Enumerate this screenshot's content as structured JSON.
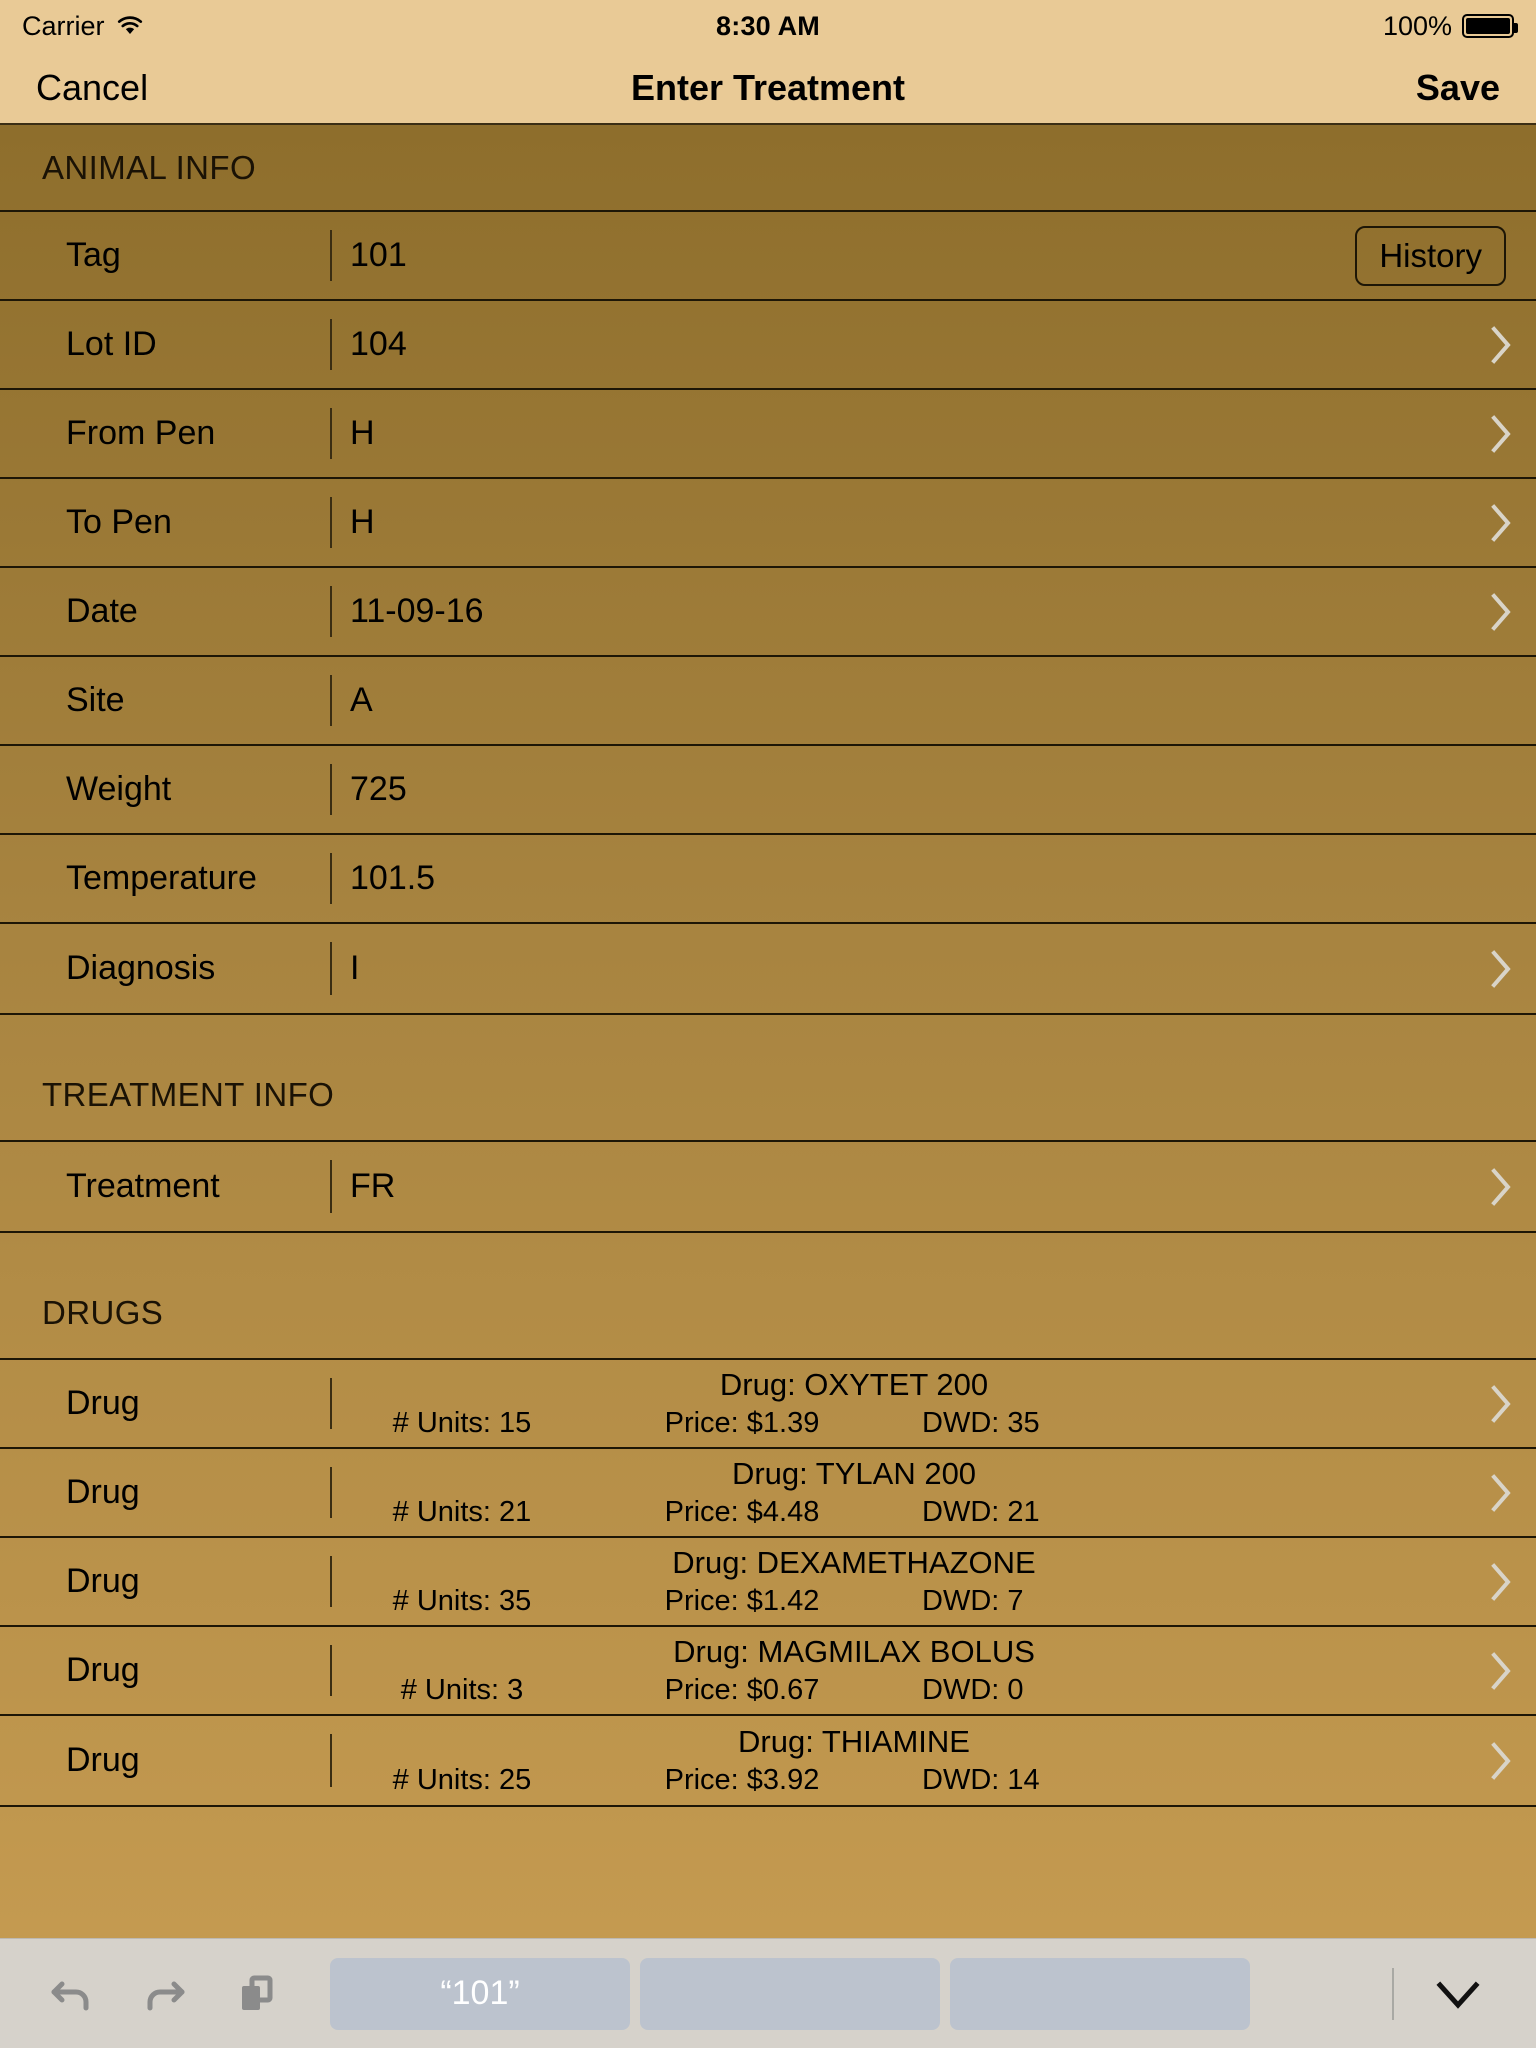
{
  "status_bar": {
    "carrier": "Carrier",
    "wifi_icon": "wifi-icon",
    "time": "8:30 AM",
    "battery_percent": "100%",
    "battery_icon": "battery-full-icon"
  },
  "nav_bar": {
    "cancel_label": "Cancel",
    "title": "Enter Treatment",
    "save_label": "Save"
  },
  "sections": {
    "animal_info": {
      "header": "ANIMAL INFO",
      "rows": [
        {
          "label": "Tag",
          "value": "101",
          "accessory": "history-button",
          "button_label": "History"
        },
        {
          "label": "Lot ID",
          "value": "104",
          "accessory": "chevron"
        },
        {
          "label": "From Pen",
          "value": "H",
          "accessory": "chevron"
        },
        {
          "label": "To Pen",
          "value": "H",
          "accessory": "chevron"
        },
        {
          "label": "Date",
          "value": "11-09-16",
          "accessory": "chevron"
        },
        {
          "label": "Site",
          "value": "A",
          "accessory": "none"
        },
        {
          "label": "Weight",
          "value": "725",
          "accessory": "none"
        },
        {
          "label": "Temperature",
          "value": "101.5",
          "accessory": "none"
        },
        {
          "label": "Diagnosis",
          "value": "I",
          "accessory": "chevron"
        }
      ]
    },
    "treatment_info": {
      "header": "TREATMENT INFO",
      "rows": [
        {
          "label": "Treatment",
          "value": "FR",
          "accessory": "chevron"
        }
      ]
    },
    "drugs": {
      "header": "DRUGS",
      "rows": [
        {
          "label": "Drug",
          "name": "Drug: OXYTET 200",
          "units": "# Units: 15",
          "price": "Price: $1.39",
          "dwd": "DWD: 35",
          "accessory": "chevron"
        },
        {
          "label": "Drug",
          "name": "Drug: TYLAN 200",
          "units": "# Units: 21",
          "price": "Price: $4.48",
          "dwd": "DWD: 21",
          "accessory": "chevron"
        },
        {
          "label": "Drug",
          "name": "Drug: DEXAMETHAZONE",
          "units": "# Units: 35",
          "price": "Price: $1.42",
          "dwd": "DWD: 7",
          "accessory": "chevron"
        },
        {
          "label": "Drug",
          "name": "Drug: MAGMILAX BOLUS",
          "units": "# Units: 3",
          "price": "Price: $0.67",
          "dwd": "DWD: 0",
          "accessory": "chevron"
        },
        {
          "label": "Drug",
          "name": "Drug: THIAMINE",
          "units": "# Units: 25",
          "price": "Price: $3.92",
          "dwd": "DWD: 14",
          "accessory": "chevron"
        }
      ]
    }
  },
  "keyboard_toolbar": {
    "undo_icon": "undo-icon",
    "redo_icon": "redo-icon",
    "paste_icon": "paste-icon",
    "suggestions": [
      {
        "text": "“101”"
      },
      {
        "text": ""
      },
      {
        "text": ""
      }
    ],
    "dismiss_icon": "chevron-down-icon"
  },
  "colors": {
    "nav_background": "#E9CA96",
    "content_top": "#8E6E2C",
    "content_bottom": "#C49A50",
    "separator": "#1D1606",
    "chevron": "#D9D4C8",
    "toolbar_background": "#D6D2CB",
    "chip_background": "#BCC3CE"
  }
}
